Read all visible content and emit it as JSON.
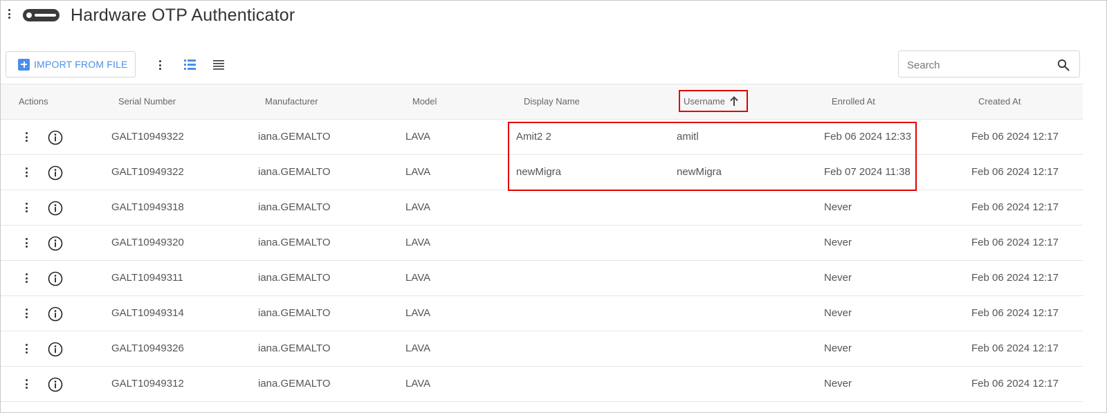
{
  "window": {
    "title": "Hardware OTP Authenticator"
  },
  "toolbar": {
    "import_label": "IMPORT FROM FILE",
    "search_placeholder": "Search"
  },
  "colors": {
    "accent": "#4a8fe7",
    "highlight": "#e00000"
  },
  "icons": [
    "kebab-menu-icon",
    "token-icon",
    "plus-icon",
    "list-view-icon",
    "compact-view-icon",
    "search-icon",
    "info-icon",
    "sort-ascending-icon"
  ],
  "table": {
    "columns": [
      "Actions",
      "Serial Number",
      "Manufacturer",
      "Model",
      "Display Name",
      "Username",
      "Enrolled At",
      "Created At"
    ],
    "sort": {
      "column": "Username",
      "direction": "ascending"
    },
    "rows": [
      {
        "serial": "GALT10949322",
        "manufacturer": "iana.GEMALTO",
        "model": "LAVA",
        "display_name": "Amit2 2",
        "username": "amitl",
        "enrolled_at": "Feb 06 2024 12:33",
        "created_at": "Feb 06 2024 12:17"
      },
      {
        "serial": "GALT10949322",
        "manufacturer": "iana.GEMALTO",
        "model": "LAVA",
        "display_name": "newMigra",
        "username": "newMigra",
        "enrolled_at": "Feb 07 2024 11:38",
        "created_at": "Feb 06 2024 12:17"
      },
      {
        "serial": "GALT10949318",
        "manufacturer": "iana.GEMALTO",
        "model": "LAVA",
        "display_name": "",
        "username": "",
        "enrolled_at": "Never",
        "created_at": "Feb 06 2024 12:17"
      },
      {
        "serial": "GALT10949320",
        "manufacturer": "iana.GEMALTO",
        "model": "LAVA",
        "display_name": "",
        "username": "",
        "enrolled_at": "Never",
        "created_at": "Feb 06 2024 12:17"
      },
      {
        "serial": "GALT10949311",
        "manufacturer": "iana.GEMALTO",
        "model": "LAVA",
        "display_name": "",
        "username": "",
        "enrolled_at": "Never",
        "created_at": "Feb 06 2024 12:17"
      },
      {
        "serial": "GALT10949314",
        "manufacturer": "iana.GEMALTO",
        "model": "LAVA",
        "display_name": "",
        "username": "",
        "enrolled_at": "Never",
        "created_at": "Feb 06 2024 12:17"
      },
      {
        "serial": "GALT10949326",
        "manufacturer": "iana.GEMALTO",
        "model": "LAVA",
        "display_name": "",
        "username": "",
        "enrolled_at": "Never",
        "created_at": "Feb 06 2024 12:17"
      },
      {
        "serial": "GALT10949312",
        "manufacturer": "iana.GEMALTO",
        "model": "LAVA",
        "display_name": "",
        "username": "",
        "enrolled_at": "Never",
        "created_at": "Feb 06 2024 12:17"
      }
    ]
  }
}
